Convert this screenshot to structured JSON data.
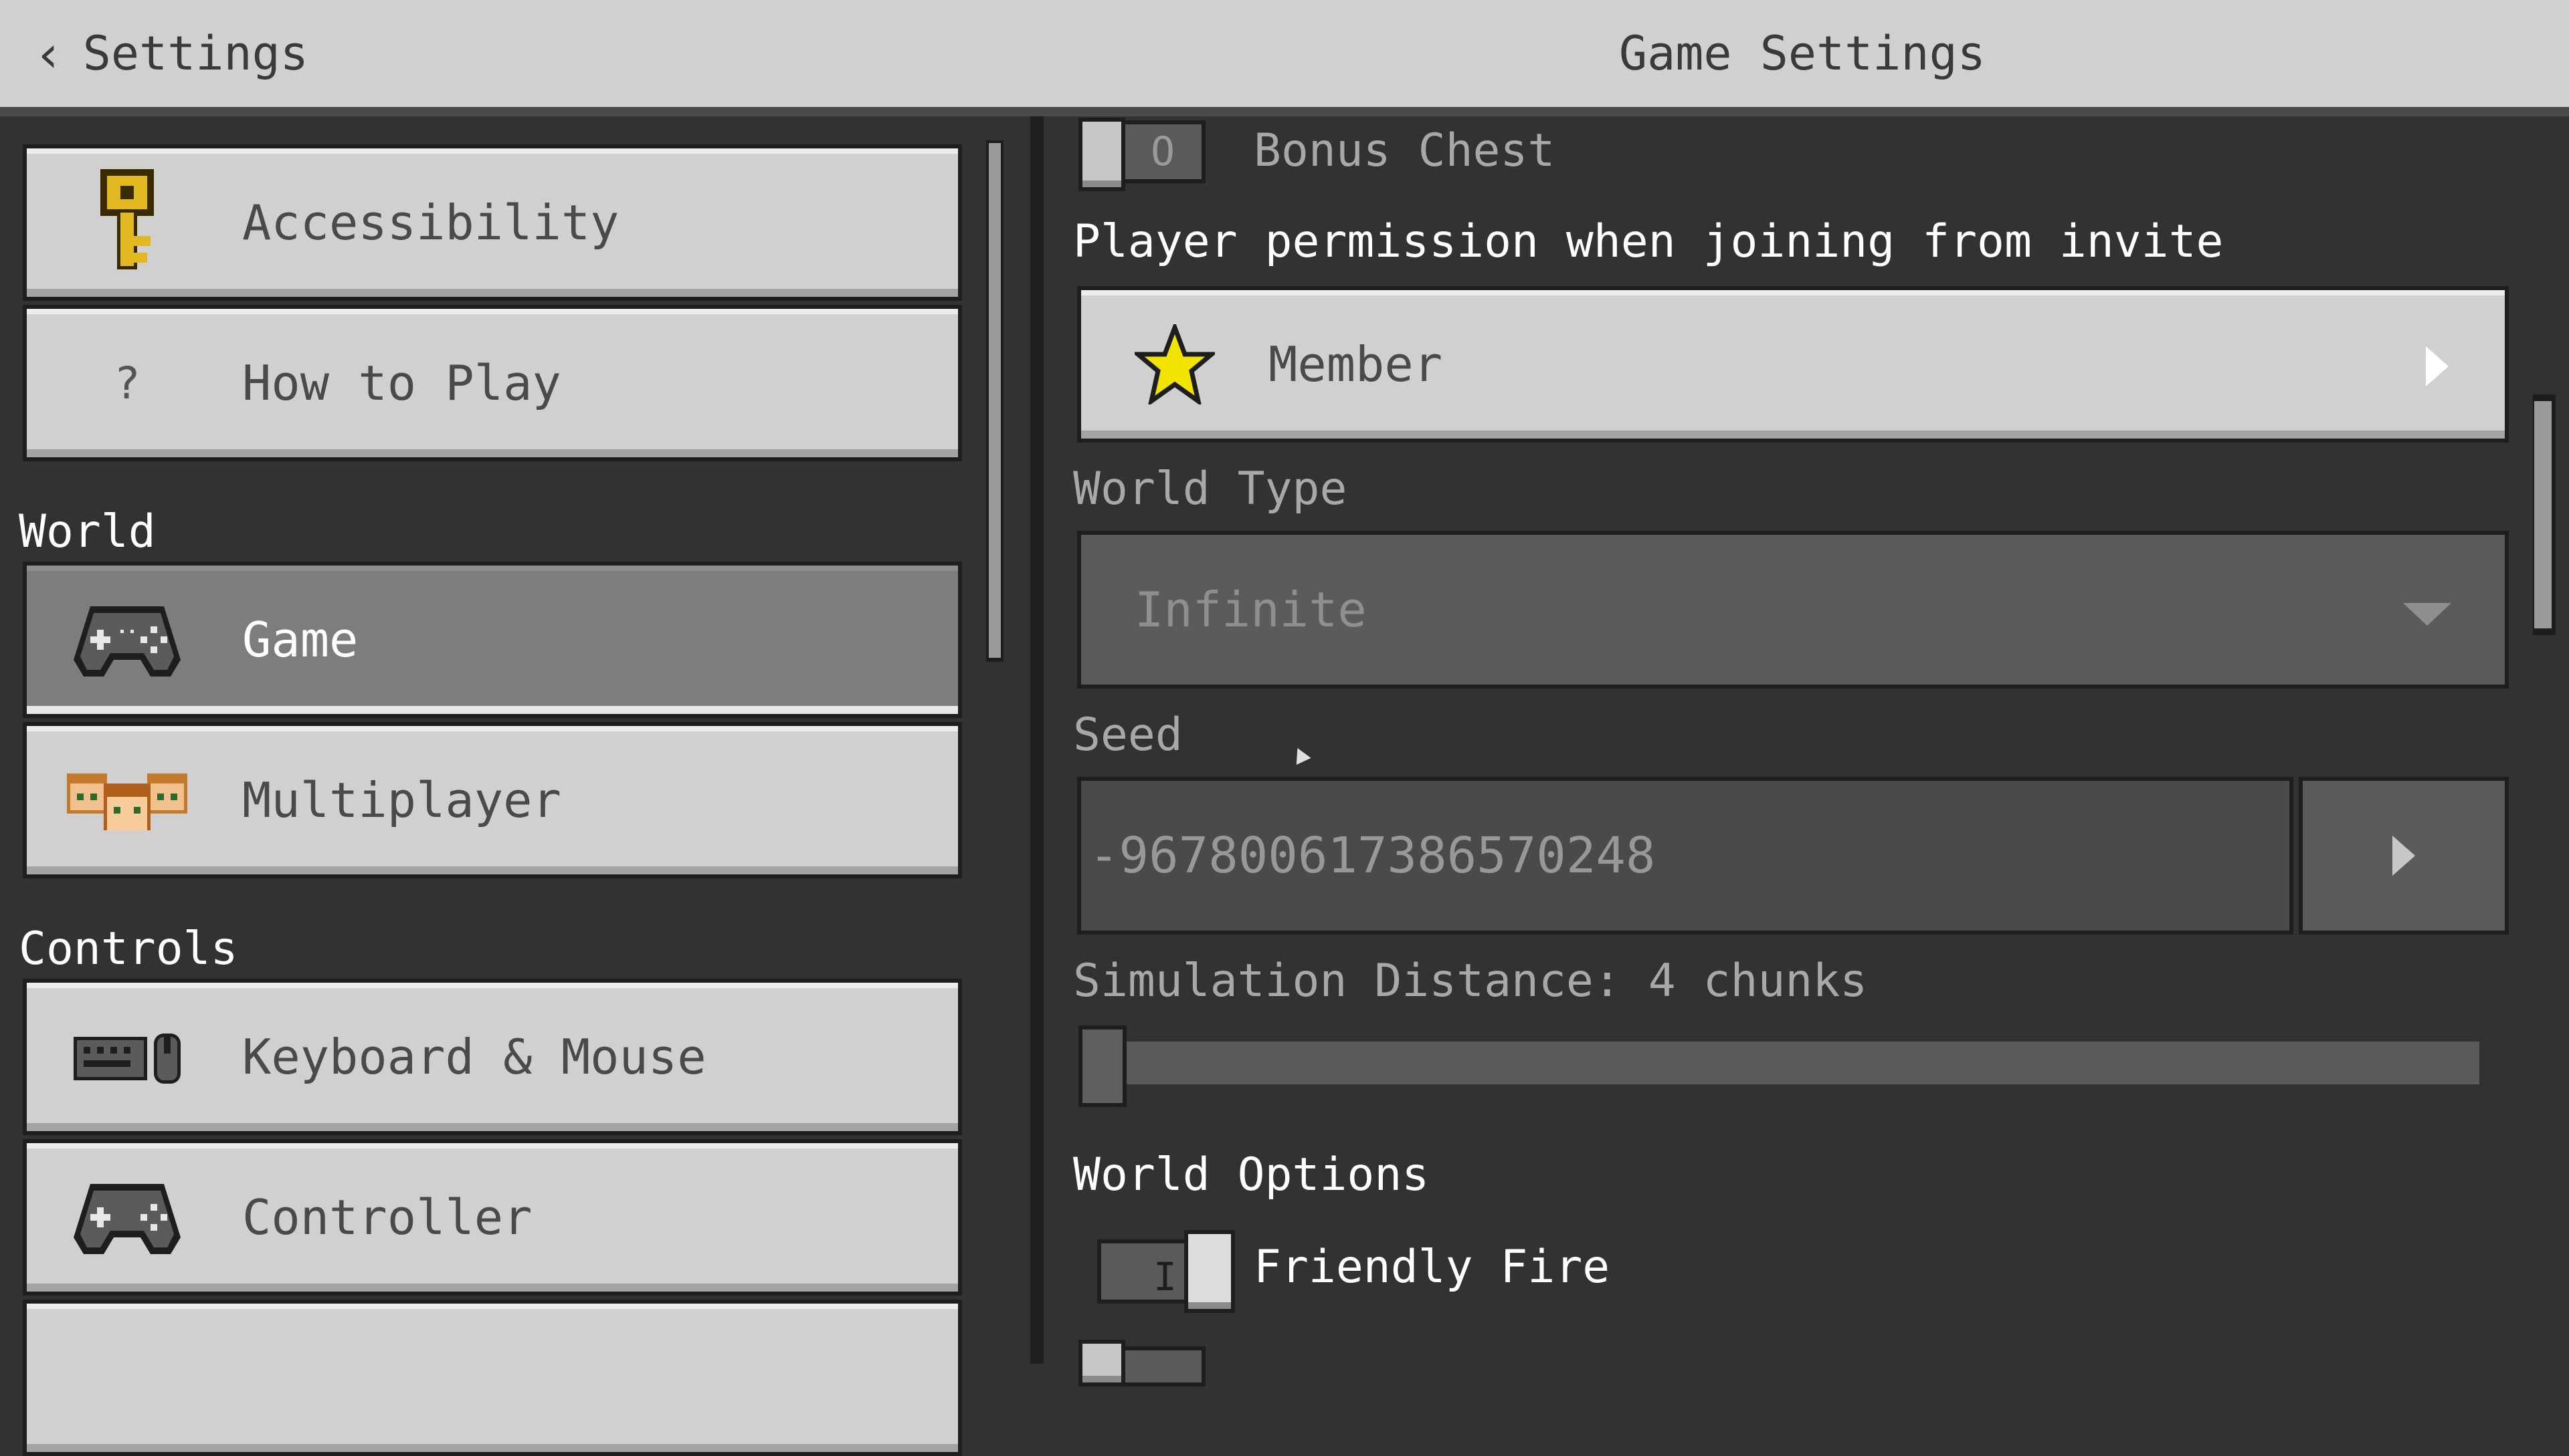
{
  "header": {
    "back_label": "Settings",
    "title": "Game Settings"
  },
  "sidebar": {
    "items_top": [
      {
        "label": "Accessibility",
        "icon": "key-icon"
      },
      {
        "label": "How to Play",
        "icon": "question-mark-icon",
        "icon_glyph": "?"
      }
    ],
    "sections": [
      {
        "title": "World",
        "items": [
          {
            "label": "Game",
            "icon": "controller-icon",
            "selected": true
          },
          {
            "label": "Multiplayer",
            "icon": "players-icon"
          }
        ]
      },
      {
        "title": "Controls",
        "items": [
          {
            "label": "Keyboard & Mouse",
            "icon": "keyboard-mouse-icon"
          },
          {
            "label": "Controller",
            "icon": "controller-icon"
          }
        ]
      }
    ]
  },
  "main": {
    "bonus_chest": {
      "label": "Bonus Chest",
      "enabled": false,
      "state_glyph": "O"
    },
    "permission": {
      "label": "Player permission when joining from invite",
      "value": "Member",
      "icon": "star-icon"
    },
    "world_type": {
      "label": "World Type",
      "value": "Infinite"
    },
    "seed": {
      "label": "Seed",
      "value": "-967800617386570248"
    },
    "simulation_distance": {
      "label": "Simulation Distance: 4 chunks",
      "chunks": 4
    },
    "world_options": {
      "title": "World Options",
      "friendly_fire": {
        "label": "Friendly Fire",
        "enabled": true,
        "state_glyph": "I"
      }
    }
  },
  "colors": {
    "header_bg": "#d0d0d0",
    "panel_bg": "#313233",
    "button_bg": "#d0d0d0",
    "selected_bg": "#7d7d7d",
    "star": "#f2e300"
  }
}
